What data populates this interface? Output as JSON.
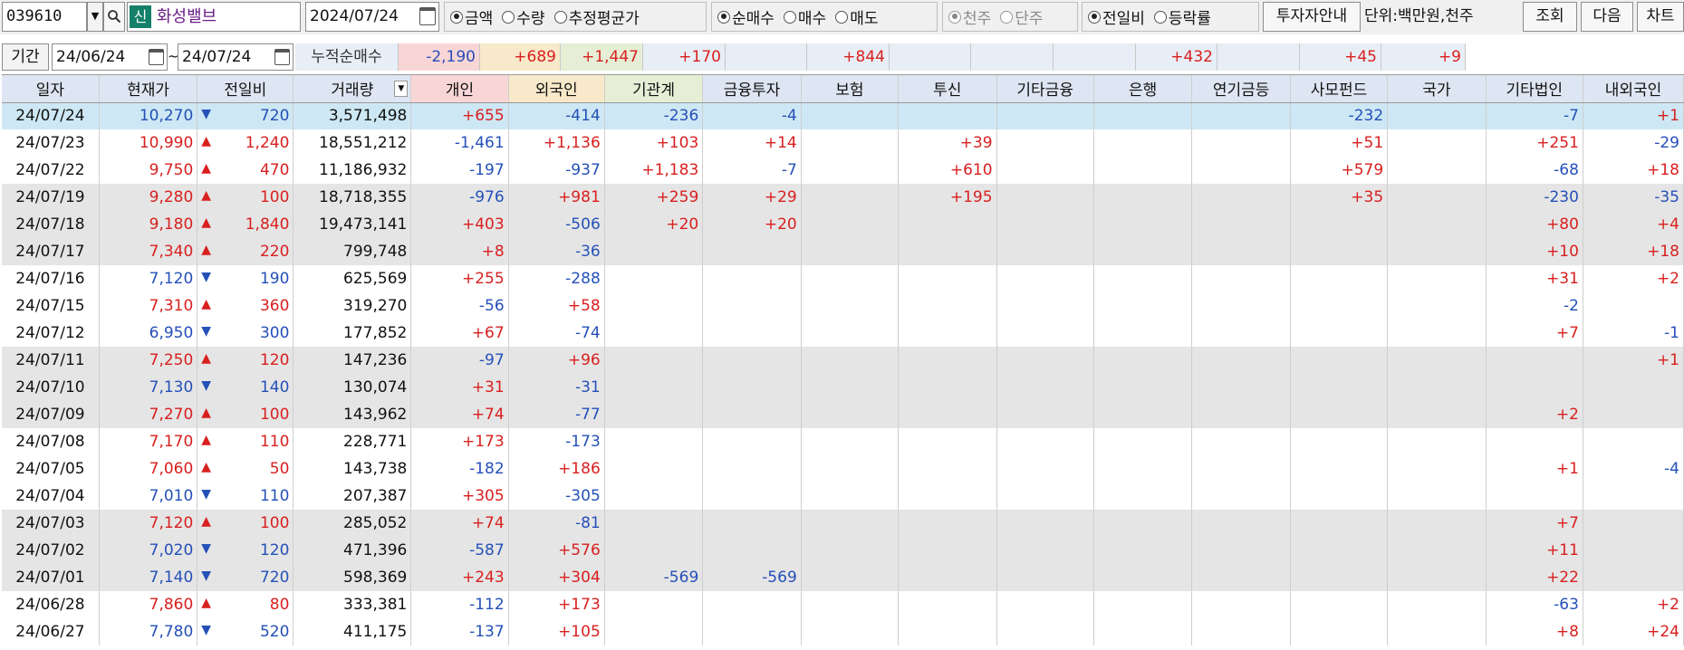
{
  "toolbar": {
    "code": "039610",
    "combo_glyph": "▼",
    "search_glyph": "🔍",
    "badge": "신",
    "stock_name": "화성밸브",
    "date": "2024/07/24",
    "group1": [
      {
        "label": "금액",
        "selected": true
      },
      {
        "label": "수량",
        "selected": false
      },
      {
        "label": "추정평균가",
        "selected": false
      }
    ],
    "group2": [
      {
        "label": "순매수",
        "selected": true
      },
      {
        "label": "매수",
        "selected": false
      },
      {
        "label": "매도",
        "selected": false
      }
    ],
    "group3": [
      {
        "label": "천주",
        "selected": true
      },
      {
        "label": "단주",
        "selected": false
      }
    ],
    "group4": [
      {
        "label": "전일비",
        "selected": true
      },
      {
        "label": "등락률",
        "selected": false
      }
    ],
    "invest_btn": "투자자안내",
    "unit": "단위:백만원,천주",
    "query_btn": "조회",
    "next_btn": "다음",
    "chart_btn": "차트"
  },
  "period": {
    "label": "기간",
    "from": "24/06/24",
    "tilde": "~",
    "to": "24/07/24"
  },
  "cumulative": {
    "label": "누적순매수",
    "values": [
      "-2,190",
      "+689",
      "+1,447",
      "+170",
      "",
      "+844",
      "",
      "",
      "",
      "+432",
      "",
      "+45",
      "+9"
    ]
  },
  "table": {
    "headers": [
      "일자",
      "현재가",
      "전일비",
      "거래량",
      "개인",
      "외국인",
      "기관계",
      "금융투자",
      "보험",
      "투신",
      "기타금융",
      "은행",
      "연기금등",
      "사모펀드",
      "국가",
      "기타법인",
      "내외국인"
    ],
    "rows": [
      {
        "date": "24/07/24",
        "price": "10,270",
        "dir": "down",
        "chg": "720",
        "vol": "3,571,498",
        "v": [
          "+655",
          "-414",
          "-236",
          "-4",
          "",
          "",
          "",
          "",
          "",
          "-232",
          "",
          "-7",
          "+1"
        ]
      },
      {
        "date": "24/07/23",
        "price": "10,990",
        "dir": "up",
        "chg": "1,240",
        "vol": "18,551,212",
        "v": [
          "-1,461",
          "+1,136",
          "+103",
          "+14",
          "",
          "+39",
          "",
          "",
          "",
          "+51",
          "",
          "+251",
          "-29"
        ]
      },
      {
        "date": "24/07/22",
        "price": "9,750",
        "dir": "up",
        "chg": "470",
        "vol": "11,186,932",
        "v": [
          "-197",
          "-937",
          "+1,183",
          "-7",
          "",
          "+610",
          "",
          "",
          "",
          "+579",
          "",
          "-68",
          "+18"
        ]
      },
      {
        "date": "24/07/19",
        "price": "9,280",
        "dir": "up",
        "chg": "100",
        "vol": "18,718,355",
        "v": [
          "-976",
          "+981",
          "+259",
          "+29",
          "",
          "+195",
          "",
          "",
          "",
          "+35",
          "",
          "-230",
          "-35"
        ]
      },
      {
        "date": "24/07/18",
        "price": "9,180",
        "dir": "up",
        "chg": "1,840",
        "vol": "19,473,141",
        "v": [
          "+403",
          "-506",
          "+20",
          "+20",
          "",
          "",
          "",
          "",
          "",
          "",
          "",
          "+80",
          "+4"
        ]
      },
      {
        "date": "24/07/17",
        "price": "7,340",
        "dir": "up",
        "chg": "220",
        "vol": "799,748",
        "v": [
          "+8",
          "-36",
          "",
          "",
          "",
          "",
          "",
          "",
          "",
          "",
          "",
          "+10",
          "+18"
        ]
      },
      {
        "date": "24/07/16",
        "price": "7,120",
        "dir": "down",
        "chg": "190",
        "vol": "625,569",
        "v": [
          "+255",
          "-288",
          "",
          "",
          "",
          "",
          "",
          "",
          "",
          "",
          "",
          "+31",
          "+2"
        ]
      },
      {
        "date": "24/07/15",
        "price": "7,310",
        "dir": "up",
        "chg": "360",
        "vol": "319,270",
        "v": [
          "-56",
          "+58",
          "",
          "",
          "",
          "",
          "",
          "",
          "",
          "",
          "",
          "-2",
          ""
        ]
      },
      {
        "date": "24/07/12",
        "price": "6,950",
        "dir": "down",
        "chg": "300",
        "vol": "177,852",
        "v": [
          "+67",
          "-74",
          "",
          "",
          "",
          "",
          "",
          "",
          "",
          "",
          "",
          "+7",
          "-1"
        ]
      },
      {
        "date": "24/07/11",
        "price": "7,250",
        "dir": "up",
        "chg": "120",
        "vol": "147,236",
        "v": [
          "-97",
          "+96",
          "",
          "",
          "",
          "",
          "",
          "",
          "",
          "",
          "",
          "",
          "+1"
        ]
      },
      {
        "date": "24/07/10",
        "price": "7,130",
        "dir": "down",
        "chg": "140",
        "vol": "130,074",
        "v": [
          "+31",
          "-31",
          "",
          "",
          "",
          "",
          "",
          "",
          "",
          "",
          "",
          "",
          ""
        ]
      },
      {
        "date": "24/07/09",
        "price": "7,270",
        "dir": "up",
        "chg": "100",
        "vol": "143,962",
        "v": [
          "+74",
          "-77",
          "",
          "",
          "",
          "",
          "",
          "",
          "",
          "",
          "",
          "+2",
          ""
        ]
      },
      {
        "date": "24/07/08",
        "price": "7,170",
        "dir": "up",
        "chg": "110",
        "vol": "228,771",
        "v": [
          "+173",
          "-173",
          "",
          "",
          "",
          "",
          "",
          "",
          "",
          "",
          "",
          "",
          ""
        ]
      },
      {
        "date": "24/07/05",
        "price": "7,060",
        "dir": "up",
        "chg": "50",
        "vol": "143,738",
        "v": [
          "-182",
          "+186",
          "",
          "",
          "",
          "",
          "",
          "",
          "",
          "",
          "",
          "+1",
          "-4"
        ]
      },
      {
        "date": "24/07/04",
        "price": "7,010",
        "dir": "down",
        "chg": "110",
        "vol": "207,387",
        "v": [
          "+305",
          "-305",
          "",
          "",
          "",
          "",
          "",
          "",
          "",
          "",
          "",
          "",
          ""
        ]
      },
      {
        "date": "24/07/03",
        "price": "7,120",
        "dir": "up",
        "chg": "100",
        "vol": "285,052",
        "v": [
          "+74",
          "-81",
          "",
          "",
          "",
          "",
          "",
          "",
          "",
          "",
          "",
          "+7",
          ""
        ]
      },
      {
        "date": "24/07/02",
        "price": "7,020",
        "dir": "down",
        "chg": "120",
        "vol": "471,396",
        "v": [
          "-587",
          "+576",
          "",
          "",
          "",
          "",
          "",
          "",
          "",
          "",
          "",
          "+11",
          ""
        ]
      },
      {
        "date": "24/07/01",
        "price": "7,140",
        "dir": "down",
        "chg": "720",
        "vol": "598,369",
        "v": [
          "+243",
          "+304",
          "-569",
          "-569",
          "",
          "",
          "",
          "",
          "",
          "",
          "",
          "+22",
          ""
        ]
      },
      {
        "date": "24/06/28",
        "price": "7,860",
        "dir": "up",
        "chg": "80",
        "vol": "333,381",
        "v": [
          "-112",
          "+173",
          "",
          "",
          "",
          "",
          "",
          "",
          "",
          "",
          "",
          "-63",
          "+2"
        ]
      },
      {
        "date": "24/06/27",
        "price": "7,780",
        "dir": "down",
        "chg": "520",
        "vol": "411,175",
        "v": [
          "-137",
          "+105",
          "",
          "",
          "",
          "",
          "",
          "",
          "",
          "",
          "",
          "+8",
          "+24"
        ]
      }
    ]
  },
  "colors": {
    "up": "#d8201f",
    "down": "#2450b8",
    "selected_row": "#cde8f4",
    "header": "#dde6f2"
  }
}
